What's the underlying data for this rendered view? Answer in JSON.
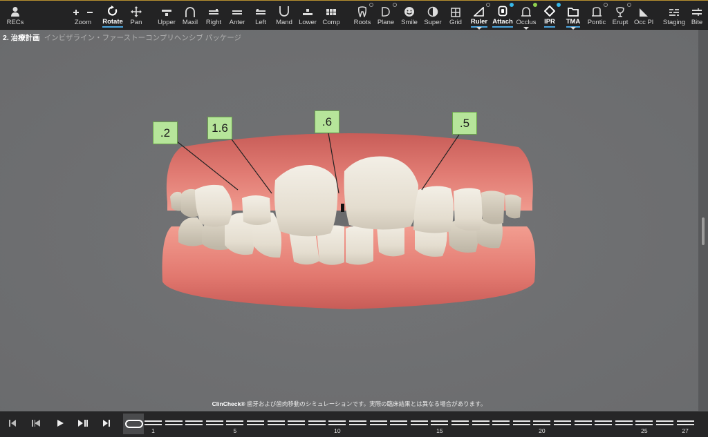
{
  "toolbar": {
    "items": [
      {
        "name": "recs",
        "label": "RECs",
        "icon": "person-icon"
      },
      {
        "name": "zoom",
        "label": "Zoom",
        "icon": "zoom-plus-minus-icon"
      },
      {
        "name": "rotate",
        "label": "Rotate",
        "icon": "rotate-icon"
      },
      {
        "name": "pan",
        "label": "Pan",
        "icon": "pan-arrows-icon"
      },
      {
        "name": "upper",
        "label": "Upper",
        "icon": "upper-view-icon"
      },
      {
        "name": "maxil",
        "label": "Maxil",
        "icon": "maxillary-arch-icon"
      },
      {
        "name": "right",
        "label": "Right",
        "icon": "right-view-icon"
      },
      {
        "name": "anter",
        "label": "Anter",
        "icon": "anterior-view-icon"
      },
      {
        "name": "left",
        "label": "Left",
        "icon": "left-view-icon"
      },
      {
        "name": "mand",
        "label": "Mand",
        "icon": "mandibular-arch-icon"
      },
      {
        "name": "lower",
        "label": "Lower",
        "icon": "lower-view-icon"
      },
      {
        "name": "comp",
        "label": "Comp",
        "icon": "compare-grid-icon"
      },
      {
        "name": "roots",
        "label": "Roots",
        "icon": "tooth-roots-icon"
      },
      {
        "name": "plane",
        "label": "Plane",
        "icon": "plane-icon"
      },
      {
        "name": "smile",
        "label": "Smile",
        "icon": "smile-face-icon"
      },
      {
        "name": "super",
        "label": "Super",
        "icon": "superimpose-icon"
      },
      {
        "name": "grid",
        "label": "Grid",
        "icon": "grid-icon"
      },
      {
        "name": "ruler",
        "label": "Ruler",
        "icon": "ruler-icon"
      },
      {
        "name": "attach",
        "label": "Attach",
        "icon": "attachment-icon"
      },
      {
        "name": "occlus",
        "label": "Occlus",
        "icon": "occlusion-icon"
      },
      {
        "name": "ipr",
        "label": "IPR",
        "icon": "ipr-diamond-icon"
      },
      {
        "name": "tma",
        "label": "TMA",
        "icon": "tma-folder-icon"
      },
      {
        "name": "pontic",
        "label": "Pontic",
        "icon": "pontic-icon"
      },
      {
        "name": "erupt",
        "label": "Erupt",
        "icon": "eruption-icon"
      },
      {
        "name": "occpl",
        "label": "Occ Pl",
        "icon": "occlusal-plane-icon"
      },
      {
        "name": "staging",
        "label": "Staging",
        "icon": "staging-icon"
      },
      {
        "name": "bite",
        "label": "Bite",
        "icon": "bite-icon"
      }
    ]
  },
  "plan": {
    "number": "2. 治療計画",
    "description": "インビザライン・ファーストーコンプリヘンシブ パッケージ"
  },
  "ipr_values": [
    ".2",
    "1.6",
    ".6",
    ".5"
  ],
  "disclaimer": {
    "brand": "ClinCheck®",
    "text": " 歯牙および歯肉移動のシミュレーションです。実際の臨床結果とは異なる場合があります。"
  },
  "playback": {
    "buttons": [
      "first-stage",
      "previous-stage",
      "play",
      "play-pause-next",
      "last-stage"
    ]
  },
  "timeline": {
    "stage_count": 27,
    "labels": [
      "1",
      "5",
      "10",
      "15",
      "20",
      "25",
      "27"
    ]
  },
  "colors": {
    "accent": "#4aa6df",
    "ipr_label_bg": "#b6e59a",
    "gum": "#e07a72",
    "tooth": "#e8e2d6"
  }
}
